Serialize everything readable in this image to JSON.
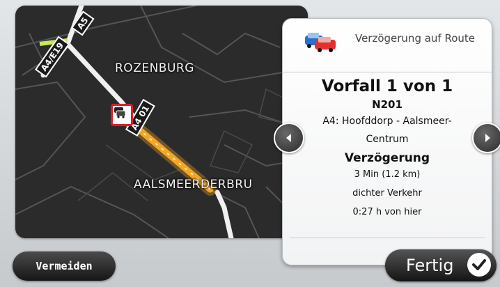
{
  "map": {
    "place_labels": [
      "ROZENBURG",
      "AALSMEERDERBRU"
    ],
    "road_shields": [
      "A5",
      "A4/E19",
      "A4 01"
    ],
    "route_color": "#ffffff",
    "incident_color": "#f6a623",
    "incident_icon": "traffic-jam-icon"
  },
  "panel": {
    "header_icon": "traffic-jam-cars-icon",
    "header_title": "Verzögerung auf Route",
    "incident_count": "Vorfall 1 von 1",
    "road_number": "N201",
    "location": "A4: Hoofddorp - Aalsmeer-Centrum",
    "delay_heading": "Verzögerung",
    "delay_value": "3 Min (1.2 km)",
    "traffic_type": "dichter Verkehr",
    "distance_from_here": "0:27 h von hier"
  },
  "nav": {
    "prev_icon": "arrow-left-icon",
    "next_icon": "arrow-right-icon"
  },
  "buttons": {
    "avoid_label": "Vermeiden",
    "done_label": "Fertig",
    "done_icon": "checkmark-icon"
  }
}
